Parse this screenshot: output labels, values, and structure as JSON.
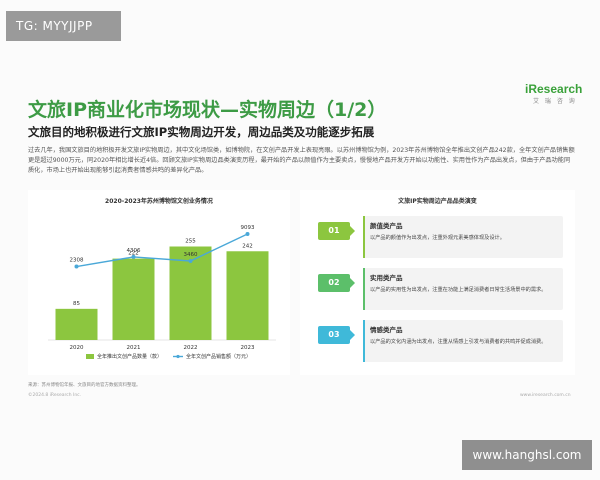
{
  "watermark_top": "TG: MYYJJPP",
  "watermark_bottom": "www.hanghsl.com",
  "logo": {
    "brand": "iResearch",
    "sub": "艾 瑞 咨 询"
  },
  "title": "文旅IP商业化市场现状—实物周边（1/2）",
  "subtitle": "文旅目的地积极进行文旅IP实物周边开发，周边品类及功能逐步拓展",
  "body": "过去几年，我国文旅目的地积极开发文旅IP实物周边，其中文化场馆类，如博物院，在文创产品开发上表现亮眼。以苏州博物馆为例，2023年苏州博物馆全年推出文创产品242款，全年文创产品销售额更是超过9000万元，同2020年相比增长近4倍。回顾文旅IP实物周边品类演变历程，最开始的产品以颜值作为主要卖点，慢慢地产品开发方开始以功能性、实用性作为产品出发点，但由于产品功能同质化，市场上也开始出现能够引起消费者情感共鸣的差异化产品。",
  "chart_data": {
    "type": "bar+line",
    "title": "2020-2023年苏州博物馆文创业务情况",
    "categories": [
      "2020",
      "2021",
      "2022",
      "2023"
    ],
    "series": [
      {
        "name": "全年推出文创产品数量（款）",
        "kind": "bar",
        "values": [
          85,
          222,
          255,
          242
        ],
        "color": "#8cc63f"
      },
      {
        "name": "全年文创产品销售额（万元）",
        "kind": "line",
        "values": [
          2308,
          4306,
          3460,
          9093
        ],
        "color": "#4aa8d8"
      }
    ],
    "legend_placement": "bottom",
    "grid": false
  },
  "right_panel": {
    "title": "文旅IP实物周边产品品类演变",
    "items": [
      {
        "num": "01",
        "label": "颜值类产品",
        "desc": "以产品的颜值作为出发点，注重外观元素美感体现及设计。",
        "color": "#8cc63f"
      },
      {
        "num": "02",
        "label": "实用类产品",
        "desc": "以产品的实用性为出发点，注重在功能上满足消费者日常生活场景中的需求。",
        "color": "#5cbf6a"
      },
      {
        "num": "03",
        "label": "情感类产品",
        "desc": "以产品的文化内涵为出发点，注重从情感上引发与消费者的共鸣并促成消费。",
        "color": "#3fb9d9"
      }
    ]
  },
  "source": "来源：苏州博物馆年报、文旅目的地官方数据资料整理。",
  "footer_left": "©2024.8 iResearch Inc.",
  "footer_right": "www.iresearch.com.cn"
}
